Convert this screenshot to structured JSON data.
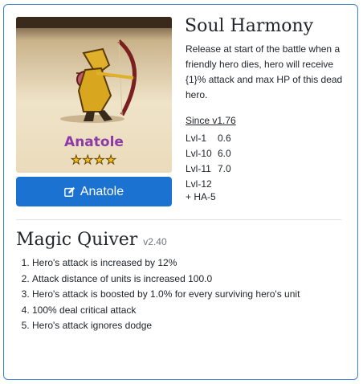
{
  "hero": {
    "name": "Anatole",
    "stars": "★★★★",
    "button_label": "Anatole"
  },
  "skill": {
    "title": "Soul Harmony",
    "description": "Release at start of the battle when a friendly hero dies, hero will receive {1}% attack and max HP of this dead hero.",
    "since": "Since v1.76",
    "levels": [
      {
        "name": "Lvl-1",
        "value": "0.6"
      },
      {
        "name": "Lvl-10",
        "value": "6.0"
      },
      {
        "name": "Lvl-11",
        "value": "7.0"
      },
      {
        "name": "Lvl-12",
        "value": ""
      }
    ],
    "extra": "+ HA-5"
  },
  "artifact": {
    "title": "Magic Quiver",
    "version": "v2.40",
    "effects": [
      "Hero's attack is increased by 12%",
      "Attack distance of units is increased 100.0",
      "Hero's attack is boosted by 1.0% for every surviving hero's unit",
      "100% deal critical attack",
      "Hero's attack ignores dodge"
    ]
  },
  "colors": {
    "accent": "#1c72d0",
    "border": "#3b7fd0",
    "hero_name": "#8e3aa6",
    "star": "#f3c21b"
  },
  "icons": {
    "button_icon": "edit-icon"
  }
}
